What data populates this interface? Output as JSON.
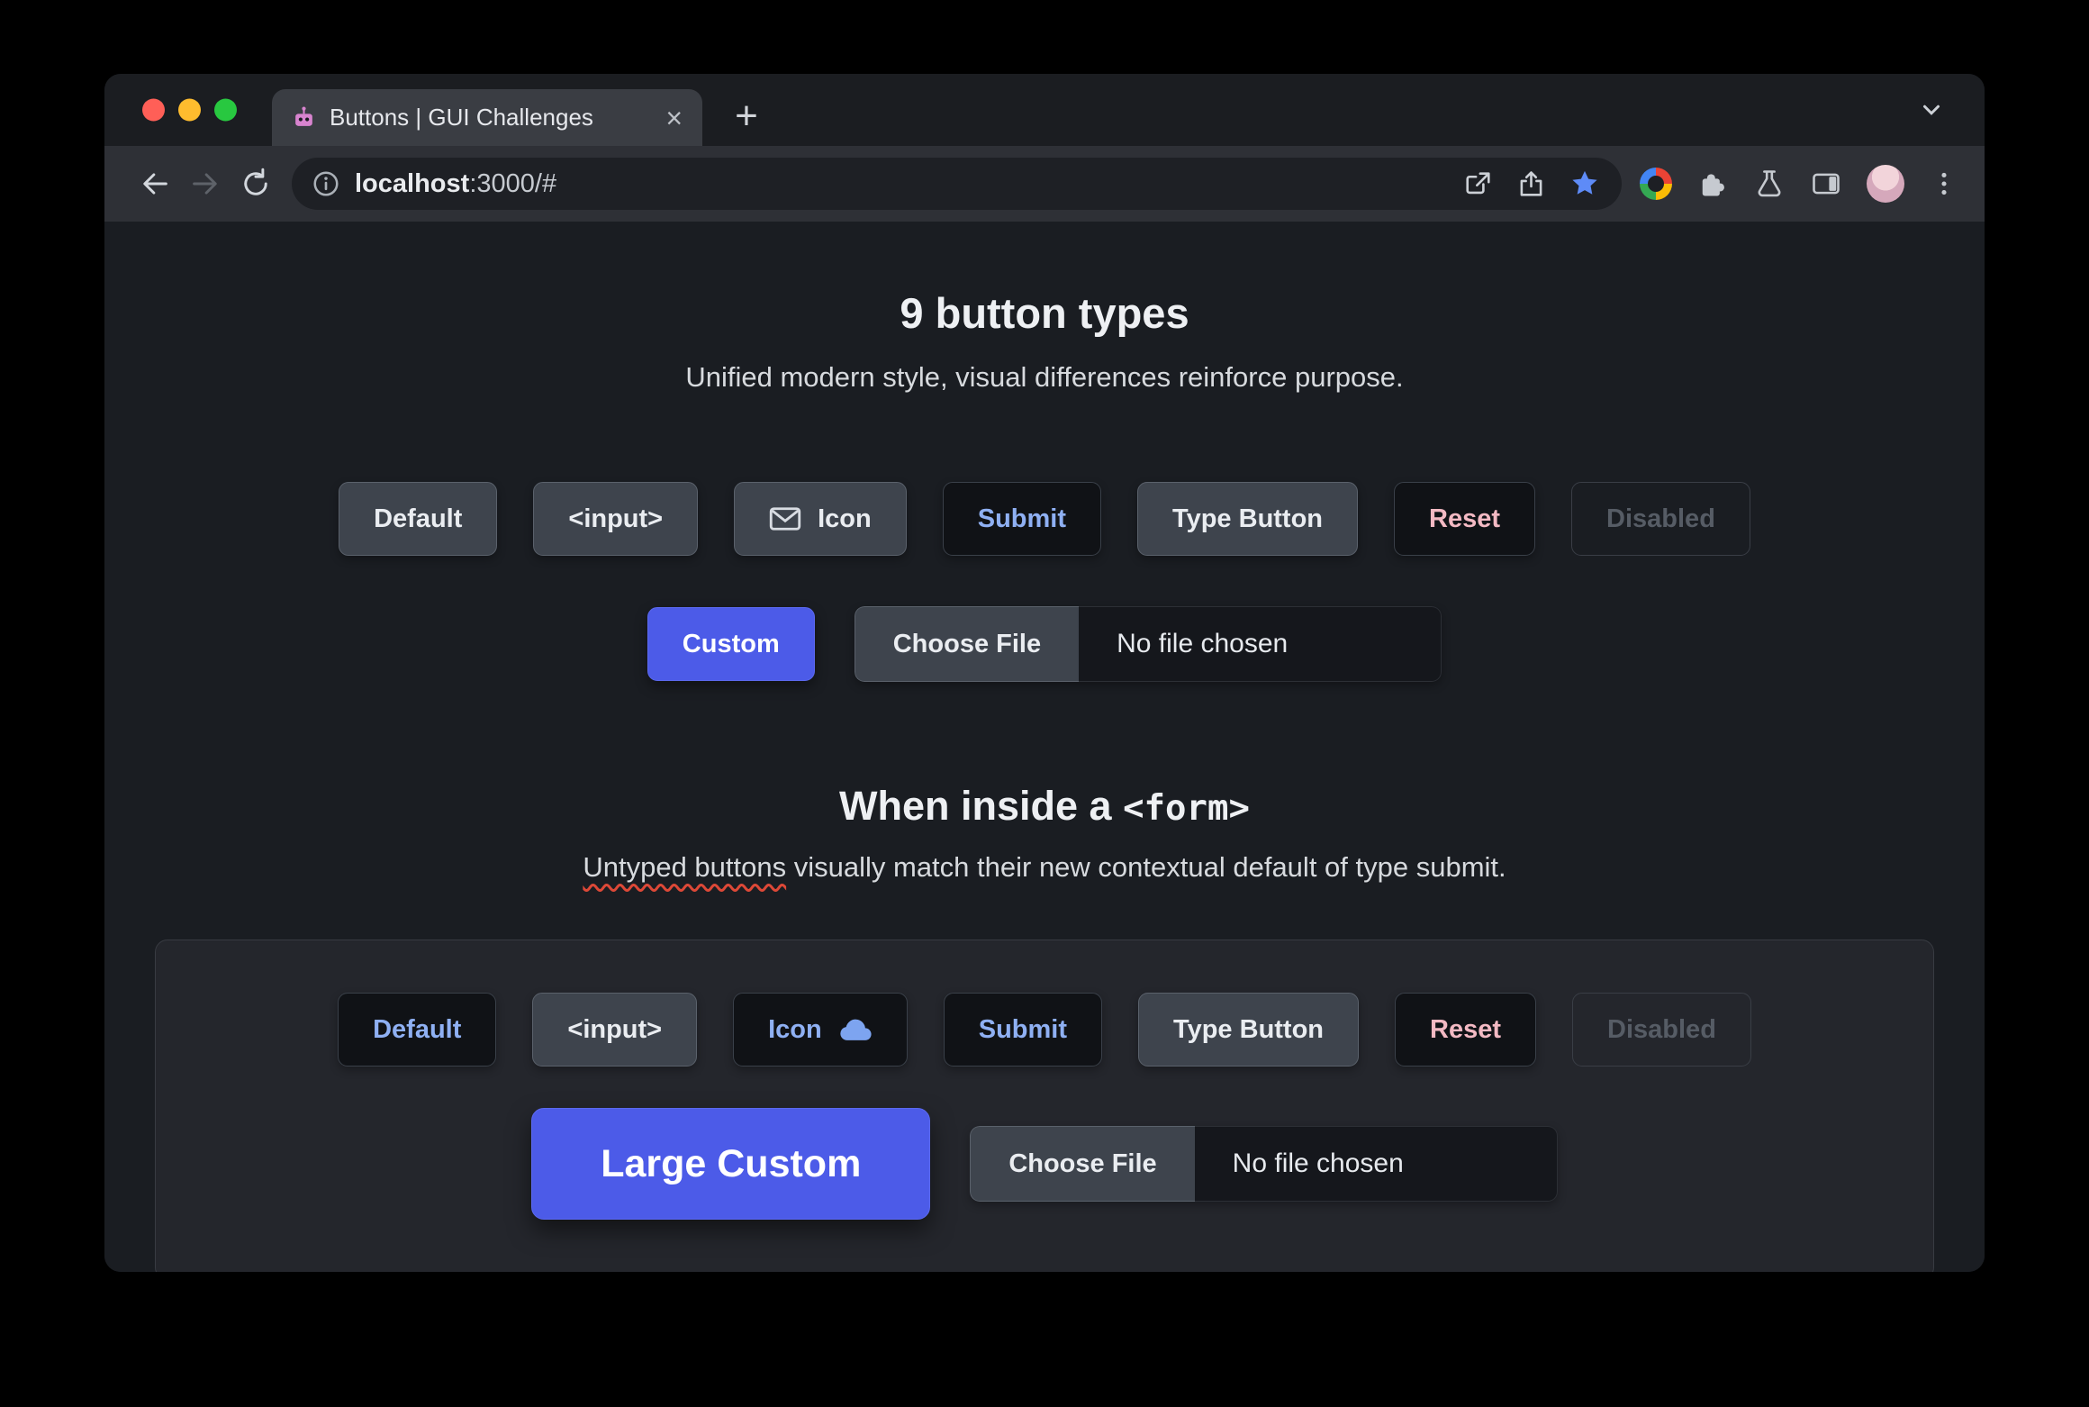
{
  "browser": {
    "tab": {
      "title": "Buttons | GUI Challenges",
      "close_label": "×"
    },
    "new_tab_label": "+",
    "url": {
      "host": "localhost",
      "rest": ":3000/#"
    }
  },
  "hero": {
    "title": "9 button types",
    "subtitle": "Unified modern style, visual differences reinforce purpose.",
    "buttons": [
      {
        "label": "Default",
        "variant": "tonal"
      },
      {
        "label": "<input>",
        "variant": "tonal"
      },
      {
        "label": "Icon",
        "variant": "tonal",
        "icon": "envelope-icon"
      },
      {
        "label": "Submit",
        "variant": "submit"
      },
      {
        "label": "Type Button",
        "variant": "tonal"
      },
      {
        "label": "Reset",
        "variant": "reset"
      },
      {
        "label": "Disabled",
        "variant": "disabled"
      }
    ],
    "custom_button": "Custom",
    "file_button": "Choose File",
    "file_status": "No file chosen"
  },
  "form_section": {
    "title_text": "When inside a ",
    "title_code": "<form>",
    "subtitle_marked": "Untyped buttons",
    "subtitle_rest": " visually match their new contextual default of type submit.",
    "buttons": [
      {
        "label": "Default",
        "variant": "submit"
      },
      {
        "label": "<input>",
        "variant": "tonal"
      },
      {
        "label": "Icon",
        "variant": "submit",
        "icon": "cloud-icon"
      },
      {
        "label": "Submit",
        "variant": "submit"
      },
      {
        "label": "Type Button",
        "variant": "tonal"
      },
      {
        "label": "Reset",
        "variant": "reset"
      },
      {
        "label": "Disabled",
        "variant": "disabled"
      }
    ],
    "custom_button": "Large Custom",
    "file_button": "Choose File",
    "file_status": "No file chosen"
  },
  "colors": {
    "accent_blue": "#8fb0f3",
    "reset_pink": "#f3b9c3",
    "custom_indigo": "#4c5be8",
    "squiggle_red": "#dd4837",
    "bookmark_star_blue": "#5e8bf7"
  },
  "icons": [
    "envelope-icon",
    "cloud-icon",
    "back-icon",
    "forward-icon",
    "reload-icon",
    "site-info-icon",
    "open-in-new-icon",
    "share-icon",
    "bookmark-star-icon",
    "color-wheel-extension-icon",
    "extensions-puzzle-icon",
    "labs-flask-icon",
    "side-panel-icon",
    "menu-kebab-icon"
  ]
}
